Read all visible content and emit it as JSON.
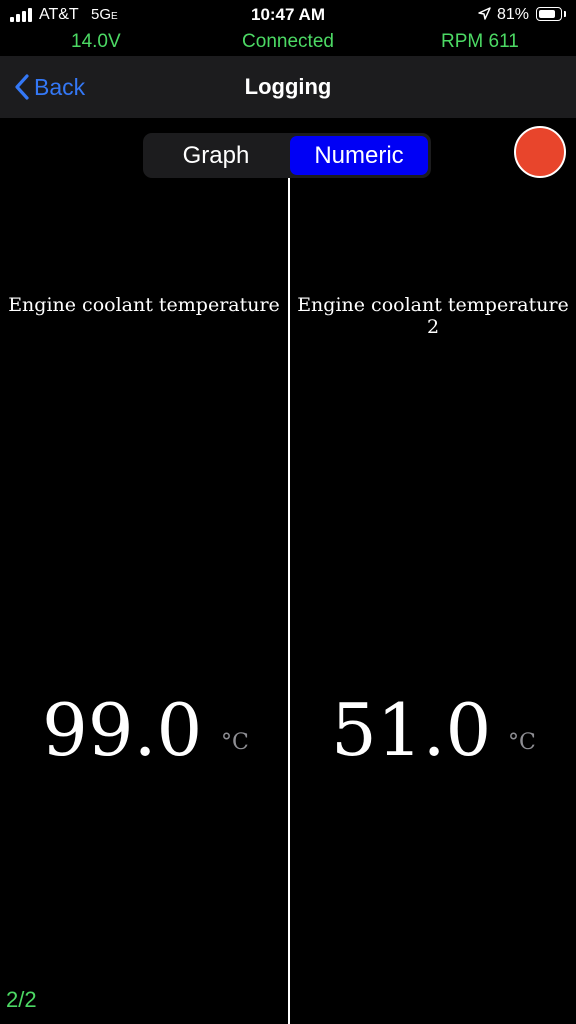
{
  "status_bar": {
    "carrier": "AT&T",
    "network": "5G",
    "network_suffix": "E",
    "time": "10:47 AM",
    "battery_percent": "81%",
    "battery_level": 0.81,
    "icons": [
      "signal-bars-icon",
      "location-arrow-icon",
      "battery-icon"
    ]
  },
  "telemetry": {
    "voltage": "14.0V",
    "connection": "Connected",
    "rpm": "RPM 611",
    "color": "#4cd964"
  },
  "nav": {
    "back_label": "Back",
    "title": "Logging",
    "accent": "#3478f6"
  },
  "segmented": {
    "options": [
      "Graph",
      "Numeric"
    ],
    "selected": "Numeric",
    "selected_color": "#0000f5"
  },
  "record_button": {
    "color": "#e8452c"
  },
  "gauges": [
    {
      "label": "Engine coolant temperature",
      "value": "99.0",
      "unit": "°C"
    },
    {
      "label": "Engine coolant temperature 2",
      "value": "51.0",
      "unit": "°C"
    }
  ],
  "page_indicator": "2/2"
}
